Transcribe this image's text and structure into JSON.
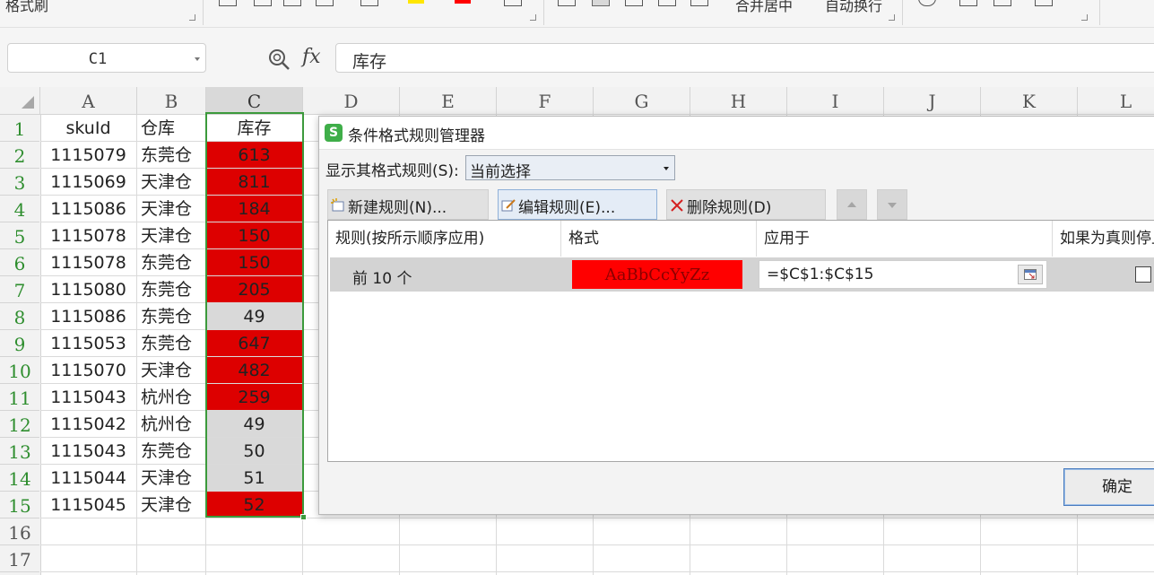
{
  "ribbon": {
    "labels": [
      "格式刷",
      "合并居中",
      "自动换行"
    ],
    "colors": {
      "highlight": "#ffe600",
      "font": "#ff0000"
    }
  },
  "formula_bar": {
    "name_box": "C1",
    "fx_label": "fx",
    "content": "库存"
  },
  "sheet": {
    "columns": [
      "A",
      "B",
      "C",
      "D",
      "E",
      "F",
      "G",
      "H",
      "I",
      "J",
      "K",
      "L"
    ],
    "rows": [
      "1",
      "2",
      "3",
      "4",
      "5",
      "6",
      "7",
      "8",
      "9",
      "10",
      "11",
      "12",
      "13",
      "14",
      "15",
      "16",
      "17"
    ],
    "headers": {
      "a": "skuId",
      "b": "仓库",
      "c": "库存"
    },
    "data": [
      {
        "sku": "1115079",
        "wh": "东莞仓",
        "qty": "613",
        "hl": true
      },
      {
        "sku": "1115069",
        "wh": "天津仓",
        "qty": "811",
        "hl": true
      },
      {
        "sku": "1115086",
        "wh": "天津仓",
        "qty": "184",
        "hl": true
      },
      {
        "sku": "1115078",
        "wh": "天津仓",
        "qty": "150",
        "hl": true
      },
      {
        "sku": "1115078",
        "wh": "东莞仓",
        "qty": "150",
        "hl": true
      },
      {
        "sku": "1115080",
        "wh": "东莞仓",
        "qty": "205",
        "hl": true
      },
      {
        "sku": "1115086",
        "wh": "东莞仓",
        "qty": "49",
        "hl": false
      },
      {
        "sku": "1115053",
        "wh": "东莞仓",
        "qty": "647",
        "hl": true
      },
      {
        "sku": "1115070",
        "wh": "天津仓",
        "qty": "482",
        "hl": true
      },
      {
        "sku": "1115043",
        "wh": "杭州仓",
        "qty": "259",
        "hl": true
      },
      {
        "sku": "1115042",
        "wh": "杭州仓",
        "qty": "49",
        "hl": false
      },
      {
        "sku": "1115043",
        "wh": "东莞仓",
        "qty": "50",
        "hl": false
      },
      {
        "sku": "1115044",
        "wh": "天津仓",
        "qty": "51",
        "hl": false
      },
      {
        "sku": "1115045",
        "wh": "天津仓",
        "qty": "52",
        "hl": true
      }
    ],
    "colors": {
      "highlight": "#dd0000",
      "plain": "#d9d9d9",
      "selection": "#3c9a3c"
    }
  },
  "dialog": {
    "logo": "S",
    "title": "条件格式规则管理器",
    "show_label": "显示其格式规则(S):",
    "show_value": "当前选择",
    "buttons": {
      "new": "新建规则(N)...",
      "edit": "编辑规则(E)...",
      "delete": "删除规则(D)"
    },
    "columns": [
      "规则(按所示顺序应用)",
      "格式",
      "应用于",
      "如果为真则停止"
    ],
    "rule": {
      "name": "前 10 个",
      "format_preview": "AaBbCcYyZz",
      "applies_to": "=$C$1:$C$15",
      "stop_if_true": false
    },
    "ok": "确定",
    "colors": {
      "preview_fill": "#ff0000"
    }
  }
}
